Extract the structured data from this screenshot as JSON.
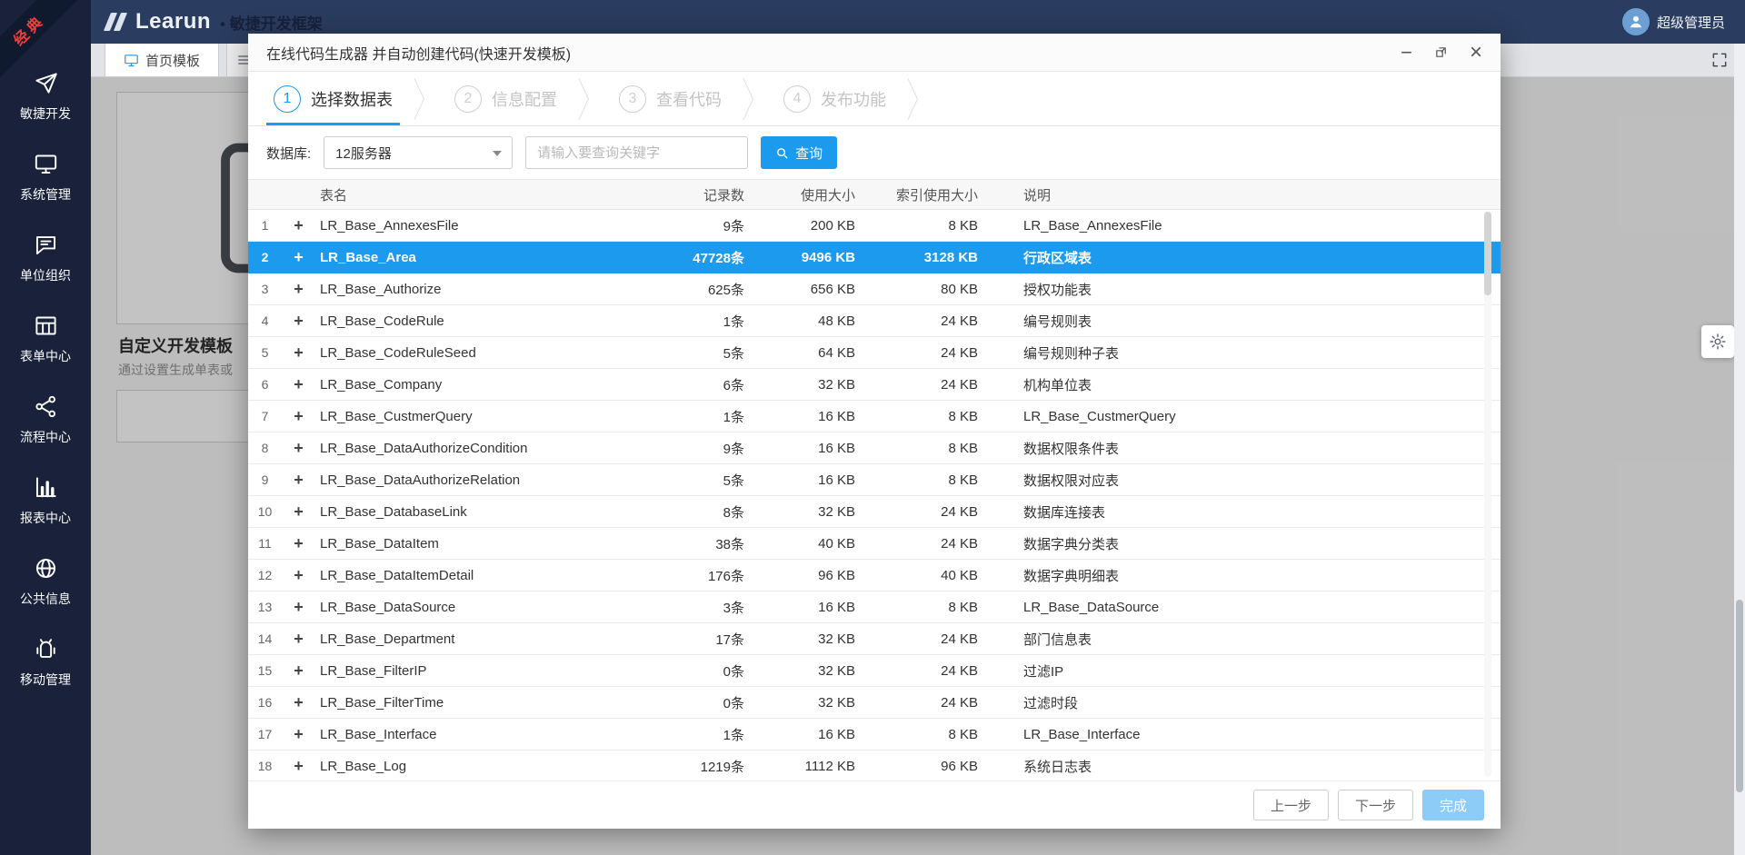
{
  "colors": {
    "accent": "#1b9aee",
    "header_bg": "#2a3c5f",
    "sidebar_bg": "#19223a",
    "selected_row_bg": "#1b9aee",
    "finish_button_bg": "#8dccf6",
    "ribbon_text": "#f1403c"
  },
  "header": {
    "brand": "Learun",
    "brand_suffix": "• 敏捷开发框架",
    "user_name": "超级管理员",
    "ribbon": "经典"
  },
  "sidebar": {
    "items": [
      {
        "id": "agile-dev",
        "label": "敏捷开发",
        "icon": "send-icon"
      },
      {
        "id": "system-mgmt",
        "label": "系统管理",
        "icon": "monitor-icon"
      },
      {
        "id": "org-unit",
        "label": "单位组织",
        "icon": "chat-icon"
      },
      {
        "id": "form-center",
        "label": "表单中心",
        "icon": "table-icon"
      },
      {
        "id": "workflow-center",
        "label": "流程中心",
        "icon": "share-icon"
      },
      {
        "id": "report-center",
        "label": "报表中心",
        "icon": "chart-icon"
      },
      {
        "id": "public-info",
        "label": "公共信息",
        "icon": "globe-icon"
      },
      {
        "id": "mobile-mgmt",
        "label": "移动管理",
        "icon": "android-icon"
      }
    ]
  },
  "tabs": {
    "active_label": "首页模板"
  },
  "content": {
    "card_title": "自定义开发模板",
    "card_desc": "通过设置生成单表或"
  },
  "modal": {
    "title": "在线代码生成器 并自动创建代码(快速开发模板)",
    "controls": {
      "minimize": "−",
      "close": "×"
    },
    "steps": [
      {
        "number": "1",
        "label": "选择数据表",
        "state": "active"
      },
      {
        "number": "2",
        "label": "信息配置",
        "state": "inactive"
      },
      {
        "number": "3",
        "label": "查看代码",
        "state": "inactive"
      },
      {
        "number": "4",
        "label": "发布功能",
        "state": "inactive"
      }
    ],
    "filter": {
      "db_label": "数据库:",
      "db_value": "12服务器",
      "search_placeholder": "请输入要查询关键字",
      "query_label": "查询"
    },
    "table": {
      "headers": [
        "表名",
        "记录数",
        "使用大小",
        "索引使用大小",
        "说明"
      ],
      "rows": [
        {
          "index": 1,
          "table_name": "LR_Base_AnnexesFile",
          "record_count": "9条",
          "used_size": "200 KB",
          "index_used_size": "8 KB",
          "description": "LR_Base_AnnexesFile",
          "selected": false
        },
        {
          "index": 2,
          "table_name": "LR_Base_Area",
          "record_count": "47728条",
          "used_size": "9496 KB",
          "index_used_size": "3128 KB",
          "description": "行政区域表",
          "selected": true
        },
        {
          "index": 3,
          "table_name": "LR_Base_Authorize",
          "record_count": "625条",
          "used_size": "656 KB",
          "index_used_size": "80 KB",
          "description": "授权功能表",
          "selected": false
        },
        {
          "index": 4,
          "table_name": "LR_Base_CodeRule",
          "record_count": "1条",
          "used_size": "48 KB",
          "index_used_size": "24 KB",
          "description": "编号规则表",
          "selected": false
        },
        {
          "index": 5,
          "table_name": "LR_Base_CodeRuleSeed",
          "record_count": "5条",
          "used_size": "64 KB",
          "index_used_size": "24 KB",
          "description": "编号规则种子表",
          "selected": false
        },
        {
          "index": 6,
          "table_name": "LR_Base_Company",
          "record_count": "6条",
          "used_size": "32 KB",
          "index_used_size": "24 KB",
          "description": "机构单位表",
          "selected": false
        },
        {
          "index": 7,
          "table_name": "LR_Base_CustmerQuery",
          "record_count": "1条",
          "used_size": "16 KB",
          "index_used_size": "8 KB",
          "description": "LR_Base_CustmerQuery",
          "selected": false
        },
        {
          "index": 8,
          "table_name": "LR_Base_DataAuthorizeCondition",
          "record_count": "9条",
          "used_size": "16 KB",
          "index_used_size": "8 KB",
          "description": "数据权限条件表",
          "selected": false
        },
        {
          "index": 9,
          "table_name": "LR_Base_DataAuthorizeRelation",
          "record_count": "5条",
          "used_size": "16 KB",
          "index_used_size": "8 KB",
          "description": "数据权限对应表",
          "selected": false
        },
        {
          "index": 10,
          "table_name": "LR_Base_DatabaseLink",
          "record_count": "8条",
          "used_size": "32 KB",
          "index_used_size": "24 KB",
          "description": "数据库连接表",
          "selected": false
        },
        {
          "index": 11,
          "table_name": "LR_Base_DataItem",
          "record_count": "38条",
          "used_size": "40 KB",
          "index_used_size": "24 KB",
          "description": "数据字典分类表",
          "selected": false
        },
        {
          "index": 12,
          "table_name": "LR_Base_DataItemDetail",
          "record_count": "176条",
          "used_size": "96 KB",
          "index_used_size": "40 KB",
          "description": "数据字典明细表",
          "selected": false
        },
        {
          "index": 13,
          "table_name": "LR_Base_DataSource",
          "record_count": "3条",
          "used_size": "16 KB",
          "index_used_size": "8 KB",
          "description": "LR_Base_DataSource",
          "selected": false
        },
        {
          "index": 14,
          "table_name": "LR_Base_Department",
          "record_count": "17条",
          "used_size": "32 KB",
          "index_used_size": "24 KB",
          "description": "部门信息表",
          "selected": false
        },
        {
          "index": 15,
          "table_name": "LR_Base_FilterIP",
          "record_count": "0条",
          "used_size": "32 KB",
          "index_used_size": "24 KB",
          "description": "过滤IP",
          "selected": false
        },
        {
          "index": 16,
          "table_name": "LR_Base_FilterTime",
          "record_count": "0条",
          "used_size": "32 KB",
          "index_used_size": "24 KB",
          "description": "过滤时段",
          "selected": false
        },
        {
          "index": 17,
          "table_name": "LR_Base_Interface",
          "record_count": "1条",
          "used_size": "16 KB",
          "index_used_size": "8 KB",
          "description": "LR_Base_Interface",
          "selected": false
        },
        {
          "index": 18,
          "table_name": "LR_Base_Log",
          "record_count": "1219条",
          "used_size": "1112 KB",
          "index_used_size": "96 KB",
          "description": "系统日志表",
          "selected": false
        }
      ]
    },
    "footer": {
      "prev_label": "上一步",
      "next_label": "下一步",
      "finish_label": "完成"
    }
  }
}
